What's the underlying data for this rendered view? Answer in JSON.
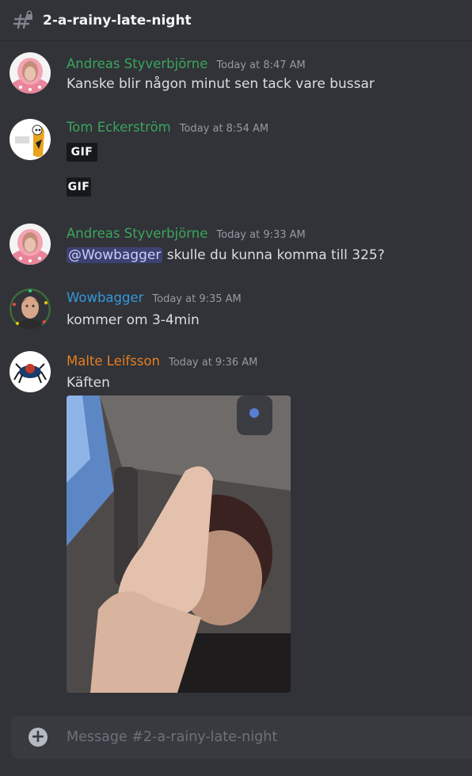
{
  "channel": {
    "name": "2-a-rainy-late-night"
  },
  "colors": {
    "andreas": "#3ba55c",
    "tom": "#3ba55c",
    "wowbagger": "#3498db",
    "malte": "#e67e22"
  },
  "messages": [
    {
      "author": "Andreas Styverbjörne",
      "timestamp": "Today at 8:47 AM",
      "text": "Kanske blir någon minut sen tack vare bussar"
    },
    {
      "author": "Tom Eckerström",
      "timestamp": "Today at 8:54 AM",
      "gif1": "GIF",
      "gif2": "GIF"
    },
    {
      "author": "Andreas Styverbjörne",
      "timestamp": "Today at 9:33 AM",
      "mention": "@Wowbagger",
      "text": " skulle du kunna komma till 325?"
    },
    {
      "author": "Wowbagger",
      "timestamp": "Today at 9:35 AM",
      "text": "kommer om 3-4min"
    },
    {
      "author": "Malte Leifsson",
      "timestamp": "Today at 9:36 AM",
      "text": "Käften"
    }
  ],
  "composer": {
    "placeholder": "Message #2-a-rainy-late-night"
  }
}
